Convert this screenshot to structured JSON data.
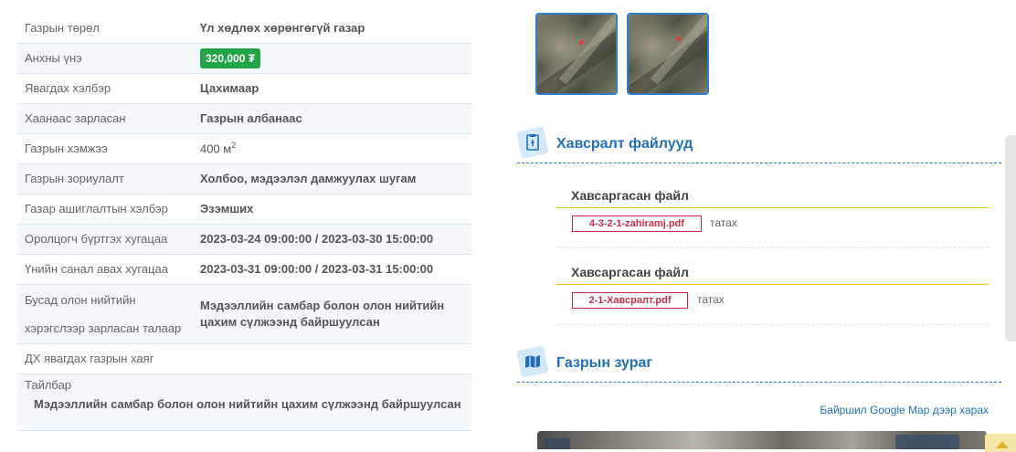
{
  "details": {
    "rows": [
      {
        "label": "Газрын төрөл",
        "value": "Үл хөдлөх хөрөнгөгүй газар"
      },
      {
        "label": "Анхны үнэ",
        "value": "320,000 ₮"
      },
      {
        "label": "Явагдах хэлбэр",
        "value": "Цахимаар"
      },
      {
        "label": "Хаанаас зарласан",
        "value": "Газрын албанаас"
      },
      {
        "label": "Газрын хэмжээ",
        "value": "400 м",
        "sup": "2"
      },
      {
        "label": "Газрын зориулалт",
        "value": "Холбоо, мэдээлэл дамжуулах шугам"
      },
      {
        "label": "Газар ашиглалтын хэлбэр",
        "value": "Эзэмших"
      },
      {
        "label": "Оролцогч бүртгэх хугацаа",
        "value": "2023-03-24 09:00:00 / 2023-03-30 15:00:00"
      },
      {
        "label": "Үнийн санал авах хугацаа",
        "value": "2023-03-31 09:00:00 / 2023-03-31 15:00:00"
      },
      {
        "label_line1": "Бусад олон нийтийн",
        "label_line2": "хэрэгслээр зарласан талаар",
        "value_line1": "Мэдээллийн самбар болон олон нийтийн",
        "value_line2": "цахим сүлжээнд байршуулсан"
      },
      {
        "label": "ДХ явагдах газрын хаяг",
        "value": ""
      },
      {
        "label": "Тайлбар",
        "value": "Мэдээллийн самбар болон олон нийтийн цахим сүлжээнд байршуулсан"
      }
    ],
    "price_color": "#23a447"
  },
  "attachments": {
    "title": "Хавсралт файлууд",
    "icon": "document-icon",
    "files": [
      {
        "heading": "Хавсаргасан файл",
        "filename": "4-3-2-1-zahiramj.pdf",
        "download": "татах"
      },
      {
        "heading": "Хавсаргасан файл",
        "filename": "2-1-Хавсралт.pdf",
        "download": "татах"
      }
    ]
  },
  "map_section": {
    "title": "Газрын зураг",
    "icon": "map-icon",
    "google_link": "Байршил Google Map дээр харах"
  },
  "colors": {
    "accent": "#2470b8",
    "file_border": "#c0304d",
    "divider_gold": "#f0c419"
  }
}
